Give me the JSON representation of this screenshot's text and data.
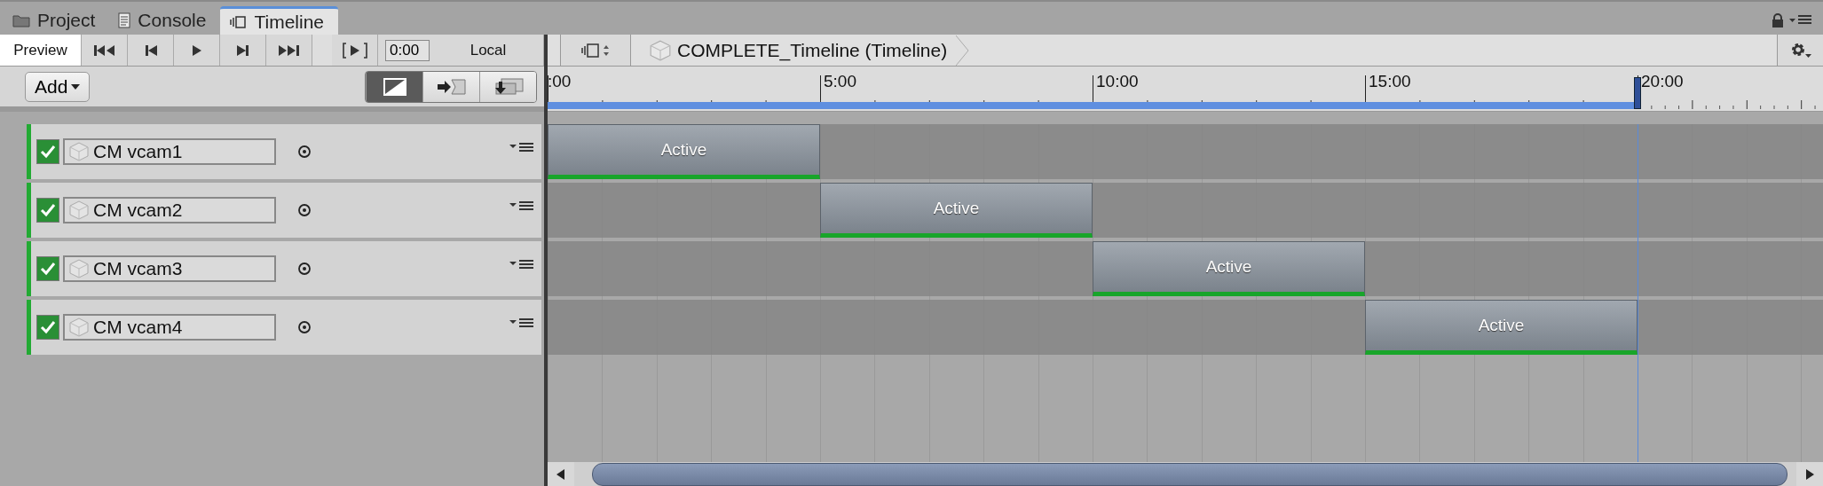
{
  "tabs": [
    {
      "label": "Project",
      "kind": "folder",
      "selected": false
    },
    {
      "label": "Console",
      "kind": "console",
      "selected": false
    },
    {
      "label": "Timeline",
      "kind": "timeline",
      "selected": true
    }
  ],
  "toolbar": {
    "preview": {
      "label": "Preview",
      "on": true
    },
    "time_field": {
      "value": "0:00"
    },
    "time_mode": "Local"
  },
  "breadcrumb": "COMPLETE_Timeline (Timeline)",
  "add_button": "Add",
  "view_modes": [
    {
      "kind": "curves",
      "selected": true
    },
    {
      "kind": "markers",
      "selected": false
    },
    {
      "kind": "stack",
      "selected": false
    }
  ],
  "ruler": {
    "labels": [
      ":00",
      "5:00",
      "10:00",
      "15:00",
      "20:00"
    ]
  },
  "tracks": [
    {
      "name": "CM vcam1",
      "enabled": true,
      "clip": {
        "label": "Active"
      }
    },
    {
      "name": "CM vcam2",
      "enabled": true,
      "clip": {
        "label": "Active"
      }
    },
    {
      "name": "CM vcam3",
      "enabled": true,
      "clip": {
        "label": "Active"
      }
    },
    {
      "name": "CM vcam4",
      "enabled": true,
      "clip": {
        "label": "Active"
      }
    }
  ]
}
